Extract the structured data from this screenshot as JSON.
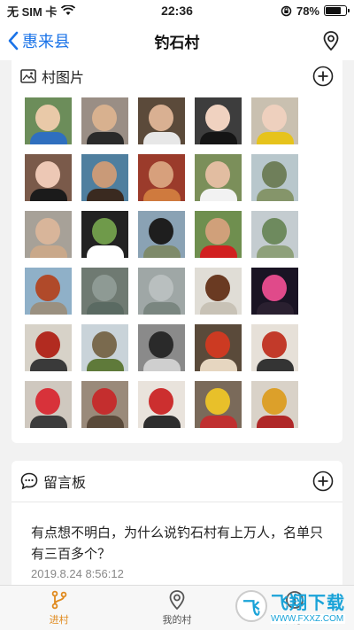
{
  "status_bar": {
    "carrier": "无 SIM 卡",
    "time": "22:36",
    "battery_percent": "78%",
    "battery_level": 0.78
  },
  "nav": {
    "back_label": "惠来县",
    "title": "钓石村"
  },
  "photos_section": {
    "title": "村图片",
    "photos": [
      {
        "colors": [
          "#6c8d5a",
          "#e9c9a8",
          "#2f6fbf"
        ]
      },
      {
        "colors": [
          "#9a8e85",
          "#d8b18f",
          "#2a2a2a"
        ]
      },
      {
        "colors": [
          "#5b4a3a",
          "#d9b092",
          "#e7e7e7"
        ]
      },
      {
        "colors": [
          "#3d3d3d",
          "#f0d2c0",
          "#151515"
        ]
      },
      {
        "colors": [
          "#c9c0b0",
          "#eed0be",
          "#e6c31c"
        ]
      },
      {
        "colors": [
          "#7a5a4a",
          "#edc8b5",
          "#1b1b1b"
        ]
      },
      {
        "colors": [
          "#4f7f9f",
          "#c99a78",
          "#3a2a20"
        ]
      },
      {
        "colors": [
          "#9b3b2b",
          "#d7a07c",
          "#cf7a3e"
        ]
      },
      {
        "colors": [
          "#7b8f5a",
          "#e2bda1",
          "#f2f2f2"
        ]
      },
      {
        "colors": [
          "#b8c7cc",
          "#6f7f5a",
          "#85956a"
        ]
      },
      {
        "colors": [
          "#a7a198",
          "#d8b59a",
          "#c9a88a"
        ]
      },
      {
        "colors": [
          "#222222",
          "#6f9a4a",
          "#ffffff"
        ]
      },
      {
        "colors": [
          "#8aa2b4",
          "#1e1e1e",
          "#7e8a6a"
        ]
      },
      {
        "colors": [
          "#6f8f4f",
          "#d0a07a",
          "#d12020"
        ]
      },
      {
        "colors": [
          "#c4ccd0",
          "#6e8a5e",
          "#8ea07a"
        ]
      },
      {
        "colors": [
          "#8fb0c8",
          "#b04a2a",
          "#9a9080"
        ]
      },
      {
        "colors": [
          "#6f7a72",
          "#8e9a94",
          "#5a6a62"
        ]
      },
      {
        "colors": [
          "#9fa7a6",
          "#b9bfbf",
          "#7a8680"
        ]
      },
      {
        "colors": [
          "#e0ddd6",
          "#6a3a22",
          "#c8c2b6"
        ]
      },
      {
        "colors": [
          "#1a1424",
          "#e04a8a",
          "#2a2030"
        ]
      },
      {
        "colors": [
          "#d7d2c8",
          "#b22b20",
          "#3a3a3a"
        ]
      },
      {
        "colors": [
          "#c9d3d9",
          "#7a6a4e",
          "#5f7a3a"
        ]
      },
      {
        "colors": [
          "#8a8a8a",
          "#2a2a2a",
          "#cfcfcf"
        ]
      },
      {
        "colors": [
          "#5a4a3a",
          "#cc3a22",
          "#e6d6c0"
        ]
      },
      {
        "colors": [
          "#e6e0d8",
          "#c23a2a",
          "#343434"
        ]
      },
      {
        "colors": [
          "#cfc8bf",
          "#d8323a",
          "#3c3c3c"
        ]
      },
      {
        "colors": [
          "#9a8a7a",
          "#c42e2e",
          "#5a4a3a"
        ]
      },
      {
        "colors": [
          "#e9e3dc",
          "#cc2f2f",
          "#2e2e2e"
        ]
      },
      {
        "colors": [
          "#7a6a5a",
          "#e8c02a",
          "#c03030"
        ]
      },
      {
        "colors": [
          "#d9d2c8",
          "#dca02a",
          "#b02828"
        ]
      }
    ]
  },
  "board_section": {
    "title": "留言板",
    "message_text": "有点想不明白，为什么说钓石村有上万人，名单只有三百多个？",
    "message_time": "2019.8.24 8:56:12"
  },
  "tabs": [
    {
      "label": "进村",
      "active": true
    },
    {
      "label": "我的村",
      "active": false
    },
    {
      "label": "关于",
      "active": false
    }
  ],
  "watermark": {
    "main": "飞翔下载",
    "sub": "WWW.FXXZ.COM"
  },
  "colors": {
    "accent_blue": "#1a73e8",
    "tab_active": "#e08a1e",
    "background": "#f2f2f2"
  }
}
